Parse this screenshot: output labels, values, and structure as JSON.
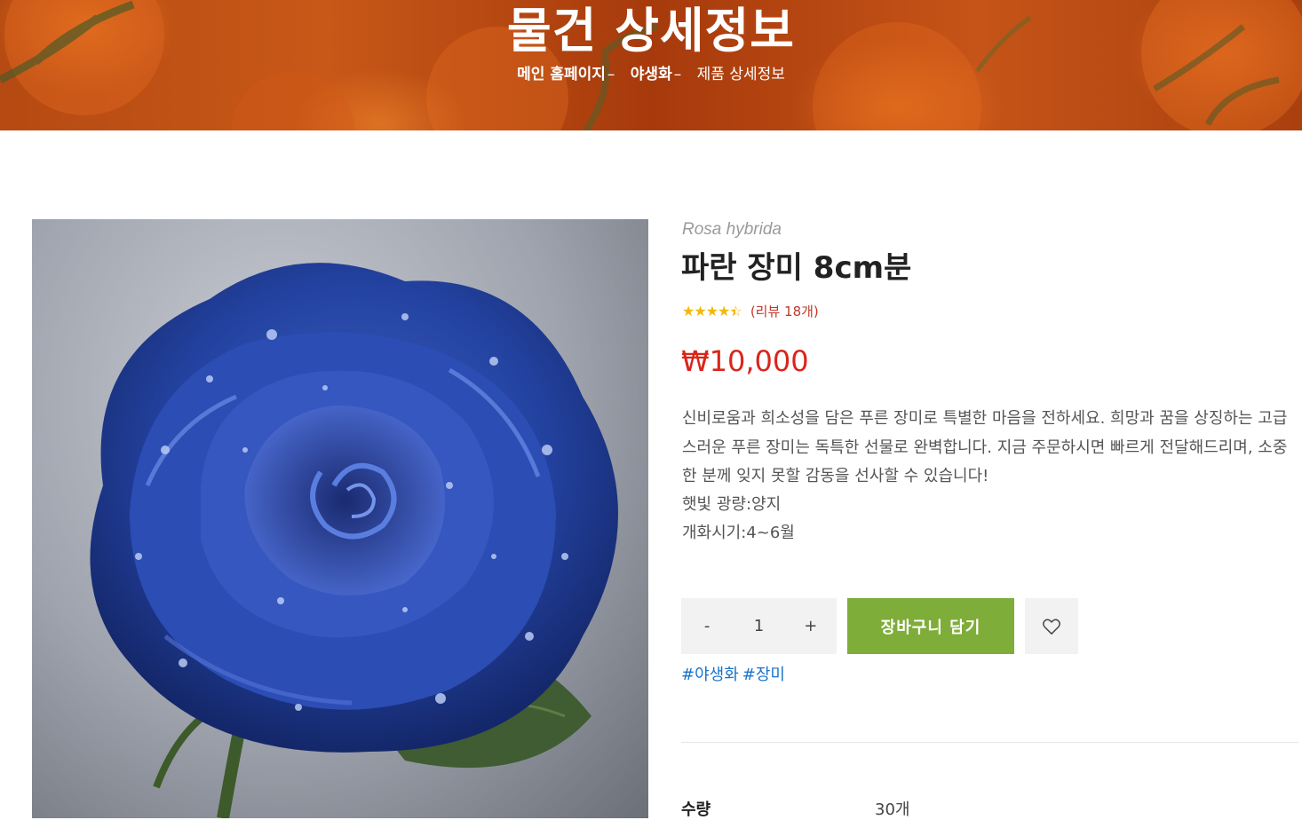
{
  "banner": {
    "title": "물건 상세정보",
    "breadcrumb": [
      "메인 홈페이지",
      "야생화",
      "제품 상세정보"
    ],
    "separator": "–"
  },
  "product": {
    "latin_name": "Rosa hybrida",
    "name": "파란 장미 8cm분",
    "rating": 4.5,
    "rating_max": 5,
    "review_text": "(리뷰 18개)",
    "price": "₩10,000",
    "description": "신비로움과 희소성을 담은 푸른 장미로 특별한 마음을 전하세요. 희망과 꿈을 상징하는 고급스러운 푸른 장미는 독특한 선물로 완벽합니다. 지금 주문하시면 빠르게 전달해드리며, 소중한 분께 잊지 못할 감동을 선사할 수 있습니다!",
    "sunlight": "햇빛 광량:양지",
    "bloom": "개화시기:4~6월",
    "quantity": {
      "minus": "-",
      "value": "1",
      "plus": "+"
    },
    "add_to_cart": "장바구니 담기",
    "wishlist_icon": "heart-icon",
    "tags": [
      "#야생화",
      "#장미"
    ],
    "stock_label": "수량",
    "stock_value": "30개"
  },
  "colors": {
    "accent_green": "#7fad39",
    "price_red": "#d9261c",
    "tag_blue": "#1a73c9",
    "star_yellow": "#f1b80e"
  }
}
